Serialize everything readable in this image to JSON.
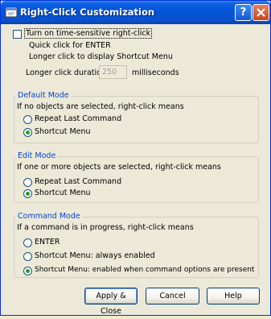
{
  "window": {
    "title": "Right-Click Customization"
  },
  "time_sensitive": {
    "checkbox_label": "Turn on time-sensitive right-click",
    "checked": false,
    "line1": "Quick click for ENTER",
    "line2": "Longer click to display Shortcut Menu",
    "duration_label": "Longer click duration:",
    "duration_value": "250",
    "duration_unit": "milliseconds"
  },
  "default_mode": {
    "title": "Default Mode",
    "description": "If no objects are selected, right-click means",
    "options": [
      "Repeat Last Command",
      "Shortcut Menu"
    ],
    "selected": 1
  },
  "edit_mode": {
    "title": "Edit Mode",
    "description": "If one or more objects are selected, right-click means",
    "options": [
      "Repeat Last Command",
      "Shortcut Menu"
    ],
    "selected": 1
  },
  "command_mode": {
    "title": "Command Mode",
    "description": "If a command is in progress, right-click means",
    "options": [
      "ENTER",
      "Shortcut Menu: always enabled",
      "Shortcut Menu: enabled when command options are present"
    ],
    "selected": 2
  },
  "buttons": {
    "apply": "Apply & Close",
    "cancel": "Cancel",
    "help": "Help"
  }
}
